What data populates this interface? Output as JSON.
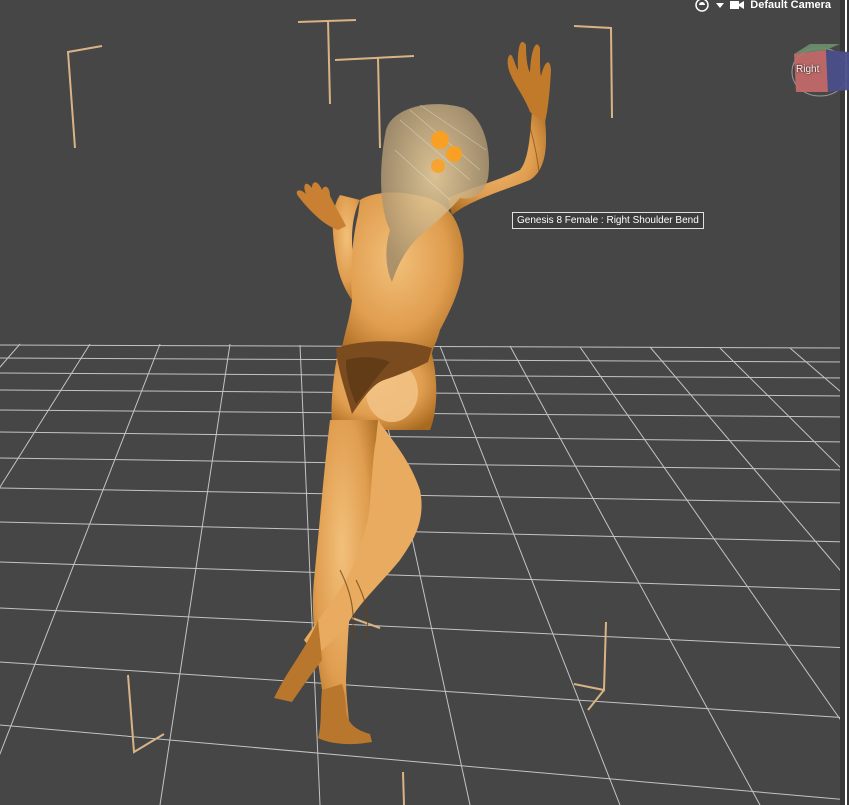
{
  "viewport": {
    "camera_label": "Default Camera",
    "tooltip": "Genesis 8 Female : Right Shoulder Bend",
    "view_cube_face": "Right",
    "icons": [
      "render-sphere-icon",
      "dropdown-arrow-icon",
      "camera-icon"
    ]
  },
  "colors": {
    "background": "#464646",
    "grid": "#dcdcdc",
    "figure": "#e2a45a",
    "figure_dark": "#b47326",
    "selection_highlight": "#ff9f1a",
    "bracket": "#d8b386"
  }
}
